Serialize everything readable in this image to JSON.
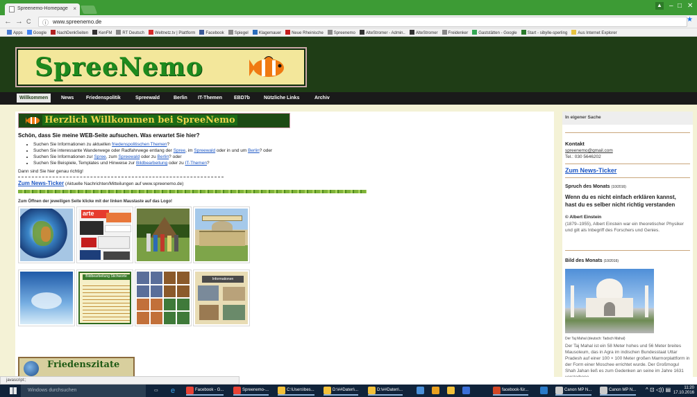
{
  "browser": {
    "tab_title": "Spreenemo-Homepage",
    "tab_close": "×",
    "url": "www.spreenemo.de",
    "nav_back": "←",
    "nav_forward": "→",
    "nav_reload": "C",
    "info_icon": "ⓘ",
    "star_icon": "★",
    "bookmarks": [
      {
        "label": "Apps",
        "color": "#4a7bd0"
      },
      {
        "label": "Google",
        "color": "#4285f4"
      },
      {
        "label": "NachDenkSeiten",
        "color": "#b22222"
      },
      {
        "label": "KenFM",
        "color": "#333333"
      },
      {
        "label": "RT Deutsch",
        "color": "#888888"
      },
      {
        "label": "Weltnetz.tv | Plattform",
        "color": "#d62b2b"
      },
      {
        "label": "Facebook",
        "color": "#3b5998"
      },
      {
        "label": "Spiegel",
        "color": "#888888"
      },
      {
        "label": "Klagemauer",
        "color": "#2a6ebb"
      },
      {
        "label": "Neue Rheinische",
        "color": "#c41e1e"
      },
      {
        "label": "Spreenemo",
        "color": "#888888"
      },
      {
        "label": "AlteStromer - Admin..",
        "color": "#333333"
      },
      {
        "label": "AlteStromer",
        "color": "#333333"
      },
      {
        "label": "Freidenker",
        "color": "#888888"
      },
      {
        "label": "Gaststätten - Google",
        "color": "#34a853"
      },
      {
        "label": "Start - sibylle-sperling",
        "color": "#2a7a2a"
      },
      {
        "label": "Aus Internet Explorer",
        "color": "#e8c440"
      }
    ],
    "status_text": "javascript:;"
  },
  "site": {
    "logo_text": "SpreeNemo",
    "nav": [
      {
        "label": "Willkommen",
        "active": true
      },
      {
        "label": "News",
        "active": false
      },
      {
        "label": "Friedenspolitik",
        "active": false
      },
      {
        "label": "Spreewald",
        "active": false
      },
      {
        "label": "Berlin",
        "active": false
      },
      {
        "label": "IT-Themen",
        "active": false
      },
      {
        "label": "EBD7b",
        "active": false
      },
      {
        "label": "Nützliche Links",
        "active": false
      },
      {
        "label": "Archiv",
        "active": false
      }
    ]
  },
  "main": {
    "banner": "Herzlich Willkommen bei SpreeNemo",
    "intro_heading": "Schön, dass Sie meine WEB-Seite aufsuchen. Was erwartet Sie hier?",
    "bullets": [
      {
        "pre": "Suchen Sie Informationen zu aktuellen ",
        "links": [
          "friedenspolitischen Themen"
        ],
        "parts": [
          "?"
        ]
      },
      {
        "pre": "Suchen Sie interessante Wanderwege oder Radfahrwege entlang der ",
        "links": [
          "Spree",
          "Spreewald",
          "Berlin"
        ],
        "parts": [
          ", im ",
          " oder in und um ",
          "?  oder"
        ]
      },
      {
        "pre": "Suchen Sie Informationen zur ",
        "links": [
          "Spree",
          "Spreewald",
          "Berlin"
        ],
        "parts": [
          ", zum ",
          " oder zu ",
          "?  oder"
        ]
      },
      {
        "pre": "Suchen Sie Beispiele, Templates und Hinweise zur ",
        "links": [
          "Bildbearbeitung",
          "IT-Themen"
        ],
        "parts": [
          " oder zu ",
          "?"
        ]
      }
    ],
    "dann": "Dann sind Sie hier genau richtig!",
    "ticker_link": "Zum News-Ticker",
    "ticker_note": " (Aktuelle Nachrichten/Mitteilungen auf www.spreenemo.de)",
    "instruction": "Zum Öffnen der jeweiligen Seite klicke mit der linken Maustaste auf das Logo!",
    "tiles": [
      {
        "name": "tile-globe"
      },
      {
        "name": "tile-news-collage"
      },
      {
        "name": "tile-spreewald-group"
      },
      {
        "name": "tile-berlin-reichstag"
      },
      {
        "name": "tile-sky-heart"
      },
      {
        "name": "tile-bildbearbeitung"
      },
      {
        "name": "tile-photo-grid"
      },
      {
        "name": "tile-it-informationen"
      }
    ],
    "friedens_label": "Friedenszitate"
  },
  "sidebar": {
    "title": "In eigener Sache",
    "kontakt_heading": "Kontakt",
    "email": "spreenemo@gmail.com",
    "tel": "Tel.: 030 5646202",
    "ticker_link": "Zum News-Ticker",
    "spruch_heading": "Spruch des Monats",
    "spruch_date": "(10/2016)",
    "quote_line1": "Wenn du es nicht einfach erklären kannst,",
    "quote_line2": "hast du es selber nicht richtig verstanden",
    "author": "© Albert Einstein",
    "author_bio": "(1879–1955), Albert Einstein war ein theoretischer Physiker und gilt als Inbegriff des Forschers und Genies.",
    "bild_heading": "Bild des Monats",
    "bild_date": "(10/2016)",
    "caption": "Der Taj Mahal (deutsch: Tadsch Mahal)",
    "desc": "Der Taj Mahal ist ein 58 Meter hohes und 56 Meter breites Mausoleum, das in Agra im indischen Bundesstaat Uttar Pradesh auf einer 100 × 100 Meter großen Marmorplattform in der Form einer Moschee errichtet wurde. Der Großmogul Shah Jahan ließ es zum Gedenken an seine im Jahre 1631 verstorbene"
  },
  "taskbar": {
    "search_placeholder": "Windows durchsuchen",
    "items": [
      {
        "label": "Facebook - G...",
        "color": "#e94235"
      },
      {
        "label": "Spreenemo-...",
        "color": "#e94235"
      },
      {
        "label": "C:\\Users\\bes...",
        "color": "#f3c13a"
      },
      {
        "label": "D:\\##Daten\\...",
        "color": "#f3c13a"
      },
      {
        "label": "D:\\##Daten\\...",
        "color": "#f3c13a"
      },
      {
        "label": "facebook-für...",
        "color": "#d24726"
      },
      {
        "label": "Canon MP N...",
        "color": "#cccccc"
      },
      {
        "label": "Canon MP N...",
        "color": "#cccccc"
      }
    ],
    "time": "11:20",
    "date": "17.10.2016"
  },
  "colors": {
    "chrome_green": "#3d9b35",
    "header_green": "#1f3d16",
    "link_blue": "#1a55c4",
    "taskbar": "#10233a"
  }
}
